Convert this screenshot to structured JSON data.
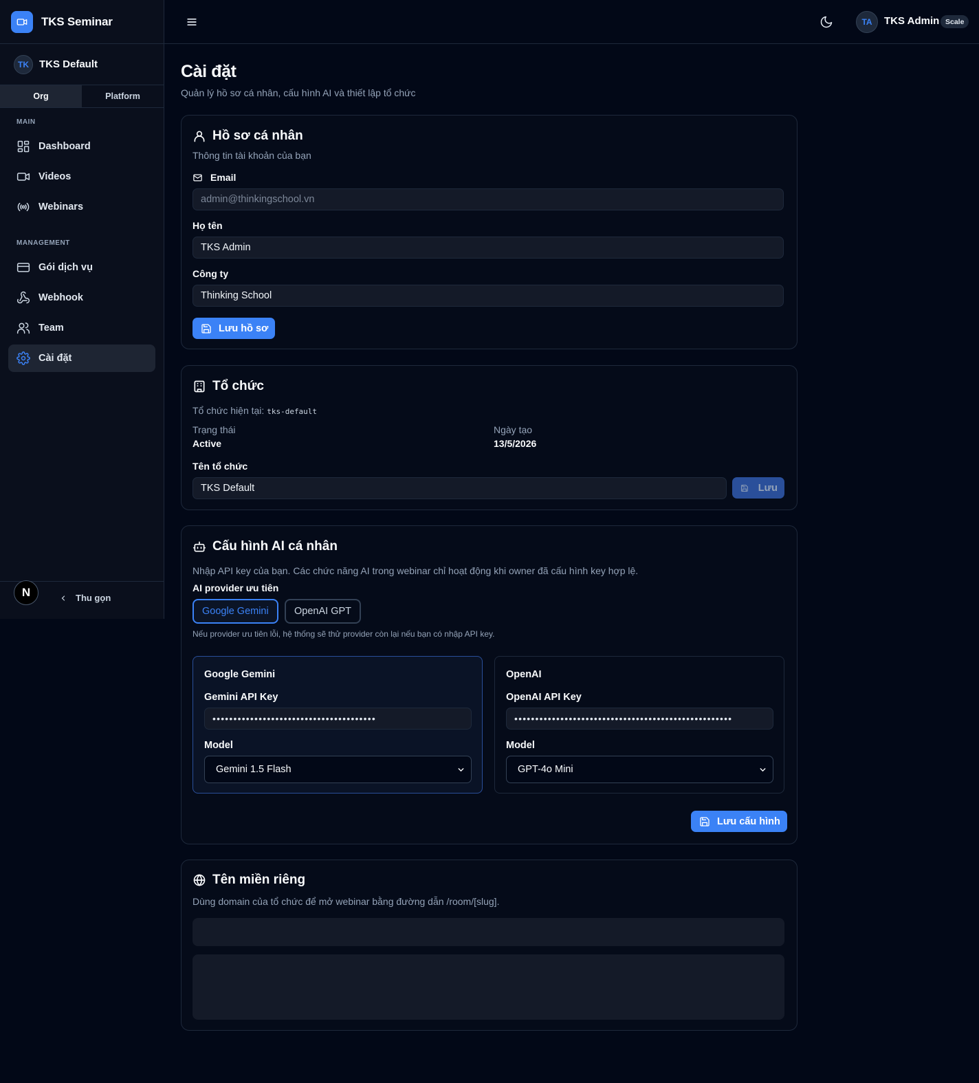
{
  "app": {
    "name": "TKS Seminar"
  },
  "org": {
    "avatar": "TK",
    "name": "TKS Default"
  },
  "scope_tabs": [
    {
      "label": "Org"
    },
    {
      "label": "Platform"
    }
  ],
  "nav": {
    "main_label": "MAIN",
    "main_items": [
      {
        "label": "Dashboard",
        "icon": "dashboard-icon"
      },
      {
        "label": "Videos",
        "icon": "video-icon"
      },
      {
        "label": "Webinars",
        "icon": "broadcast-icon"
      }
    ],
    "management_label": "MANAGEMENT",
    "management_items": [
      {
        "label": "Gói dịch vụ",
        "icon": "credit-card-icon"
      },
      {
        "label": "Webhook",
        "icon": "webhook-icon"
      },
      {
        "label": "Team",
        "icon": "users-icon"
      },
      {
        "label": "Cài đặt",
        "icon": "gear-icon",
        "active": true
      }
    ],
    "collapse_label": "Thu gọn",
    "footer_badge": "N"
  },
  "topbar": {
    "user_initials": "TA",
    "user_name": "TKS Admin",
    "plan_badge": "Scale"
  },
  "page": {
    "title": "Cài đặt",
    "subtitle": "Quản lý hồ sơ cá nhân, cấu hình AI và thiết lập tổ chức"
  },
  "profile": {
    "title": "Hồ sơ cá nhân",
    "desc": "Thông tin tài khoản của bạn",
    "email_label": "Email",
    "email_value": "admin@thinkingschool.vn",
    "name_label": "Họ tên",
    "name_value": "TKS Admin",
    "company_label": "Công ty",
    "company_value": "Thinking School",
    "save_label": "Lưu hồ sơ"
  },
  "organization": {
    "title": "Tổ chức",
    "desc_prefix": "Tổ chức hiện tại:",
    "slug": "tks-default",
    "status_label": "Trạng thái",
    "status_value": "Active",
    "created_label": "Ngày tạo",
    "created_value": "13/5/2026",
    "name_label": "Tên tổ chức",
    "name_value": "TKS Default",
    "save_label": "Lưu"
  },
  "ai_config": {
    "title": "Cấu hình AI cá nhân",
    "desc": "Nhập API key của bạn. Các chức năng AI trong webinar chỉ hoạt động khi owner đã cấu hình key hợp lệ.",
    "provider_label": "AI provider ưu tiên",
    "providers": [
      {
        "label": "Google Gemini",
        "selected": true
      },
      {
        "label": "OpenAI GPT",
        "selected": false
      }
    ],
    "fallback_note": "Nếu provider ưu tiên lỗi, hệ thống sẽ thử provider còn lại nếu bạn có nhập API key.",
    "gemini": {
      "title": "Google Gemini",
      "key_label": "Gemini API Key",
      "key_mask": "•••••••••••••••••••••••••••••••••••••••",
      "model_label": "Model",
      "model_value": "Gemini 1.5 Flash"
    },
    "openai": {
      "title": "OpenAI",
      "key_label": "OpenAI API Key",
      "key_mask": "••••••••••••••••••••••••••••••••••••••••••••••••••••",
      "model_label": "Model",
      "model_value": "GPT-4o Mini"
    },
    "save_label": "Lưu cấu hình"
  },
  "domain": {
    "title": "Tên miền riêng",
    "desc": "Dùng domain của tổ chức để mở webinar bằng đường dẫn /room/[slug]."
  },
  "colors": {
    "accent": "#3b82f6",
    "background": "#020817",
    "sidebar": "#0a0f1c",
    "border": "#1e293b"
  }
}
